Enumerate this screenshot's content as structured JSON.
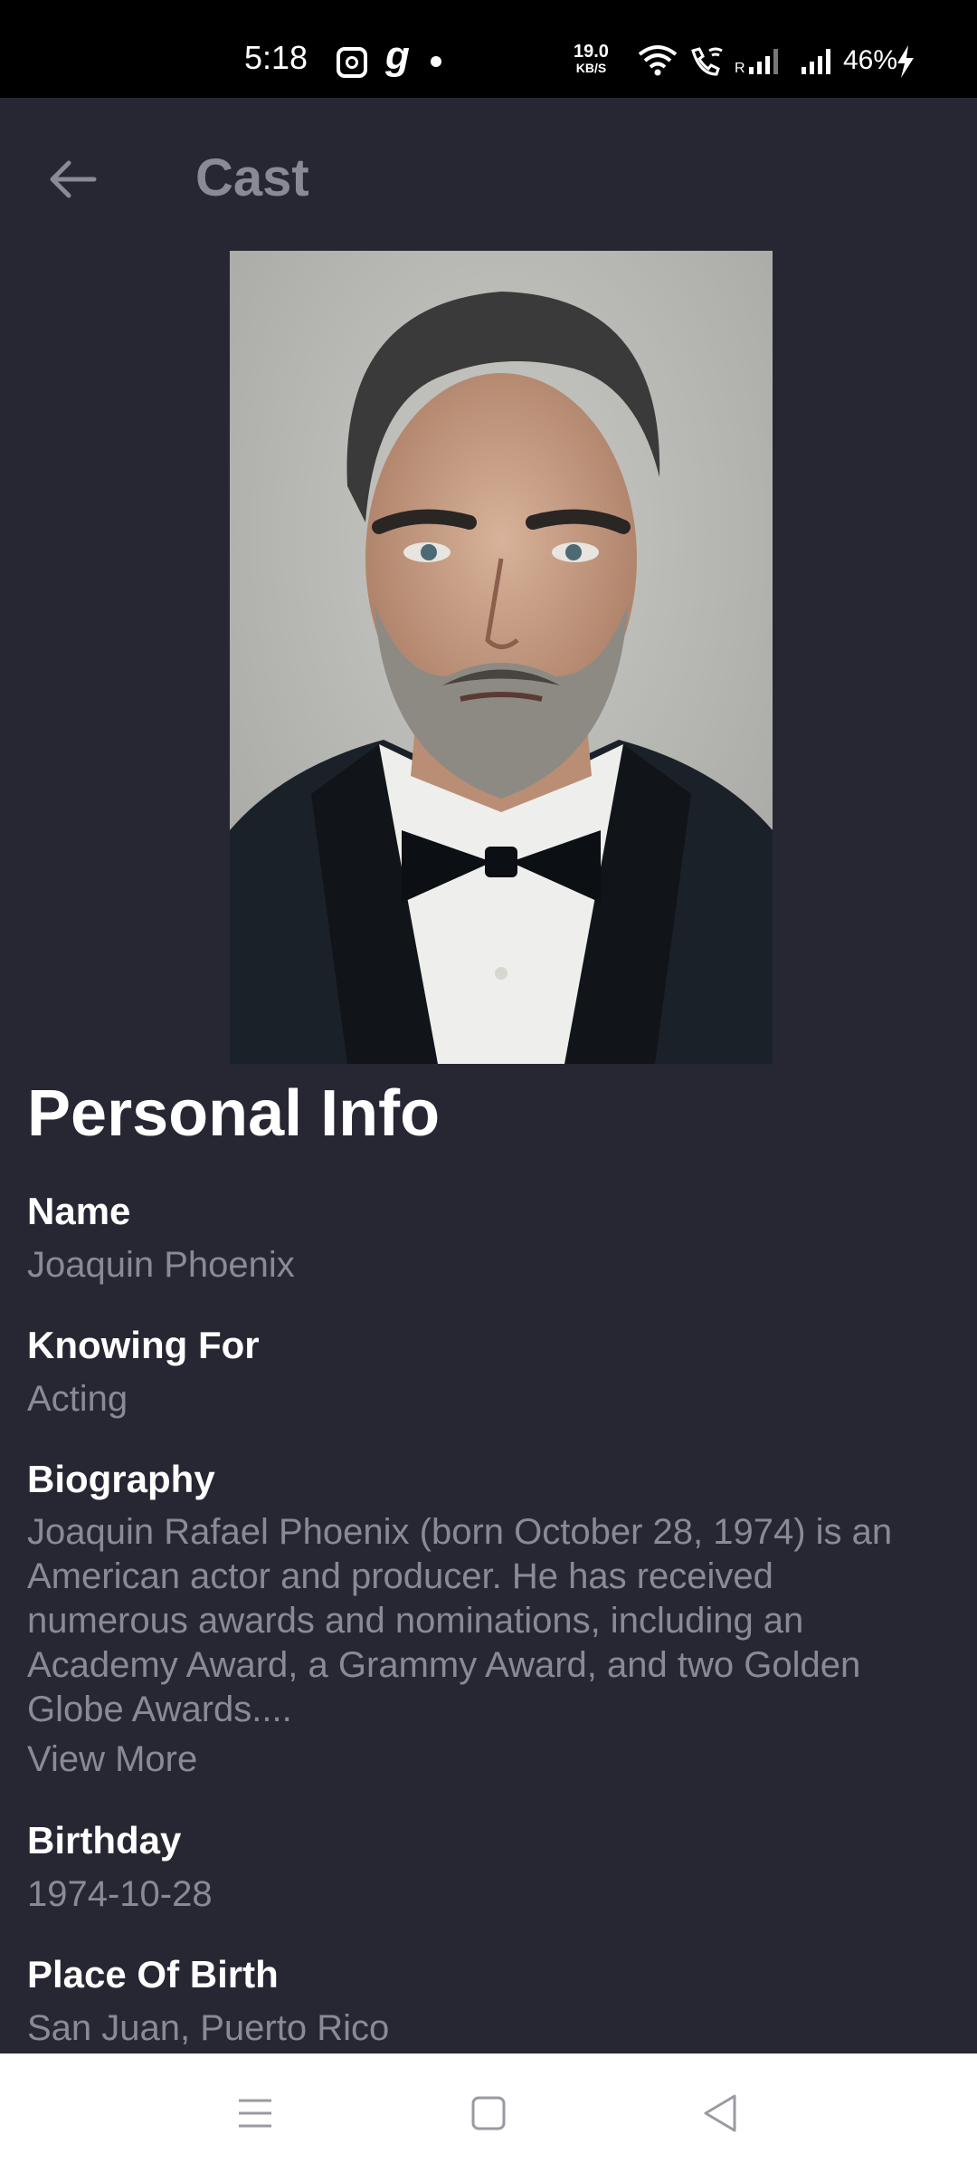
{
  "status_bar": {
    "time": "5:18",
    "g_glyph": "g",
    "speed_value": "19.0",
    "speed_unit": "KB/S",
    "roaming": "R",
    "battery": "46%",
    "icons": [
      "instagram-icon",
      "app-g-icon",
      "notification-dot-icon",
      "wifi-icon",
      "wifi-call-icon",
      "signal-icon",
      "battery-charging-icon"
    ]
  },
  "app_bar": {
    "title": "Cast",
    "back_icon": "arrow-left-icon"
  },
  "personal_info": {
    "section_title": "Personal Info",
    "fields": [
      {
        "label": "Name",
        "value": "Joaquin Phoenix"
      },
      {
        "label": "Knowing For",
        "value": "Acting"
      },
      {
        "label": "Biography",
        "value": "Joaquin Rafael Phoenix (born October 28, 1974) is an American actor and producer. He has received numerous awards and nominations, including an Academy Award, a Grammy Award, and two Golden Globe Awards...."
      },
      {
        "label": "Birthday",
        "value": "1974-10-28"
      },
      {
        "label": "Place Of Birth",
        "value": "San Juan, Puerto Rico"
      }
    ],
    "view_more_label": "View More"
  },
  "nav_bar": {
    "icons": [
      "menu-icon",
      "home-square-icon",
      "back-triangle-icon"
    ]
  },
  "colors": {
    "background": "#272734",
    "label": "#ffffff",
    "value": "#8a8a94",
    "status_bar": "#000000",
    "nav_bar": "#ffffff"
  }
}
